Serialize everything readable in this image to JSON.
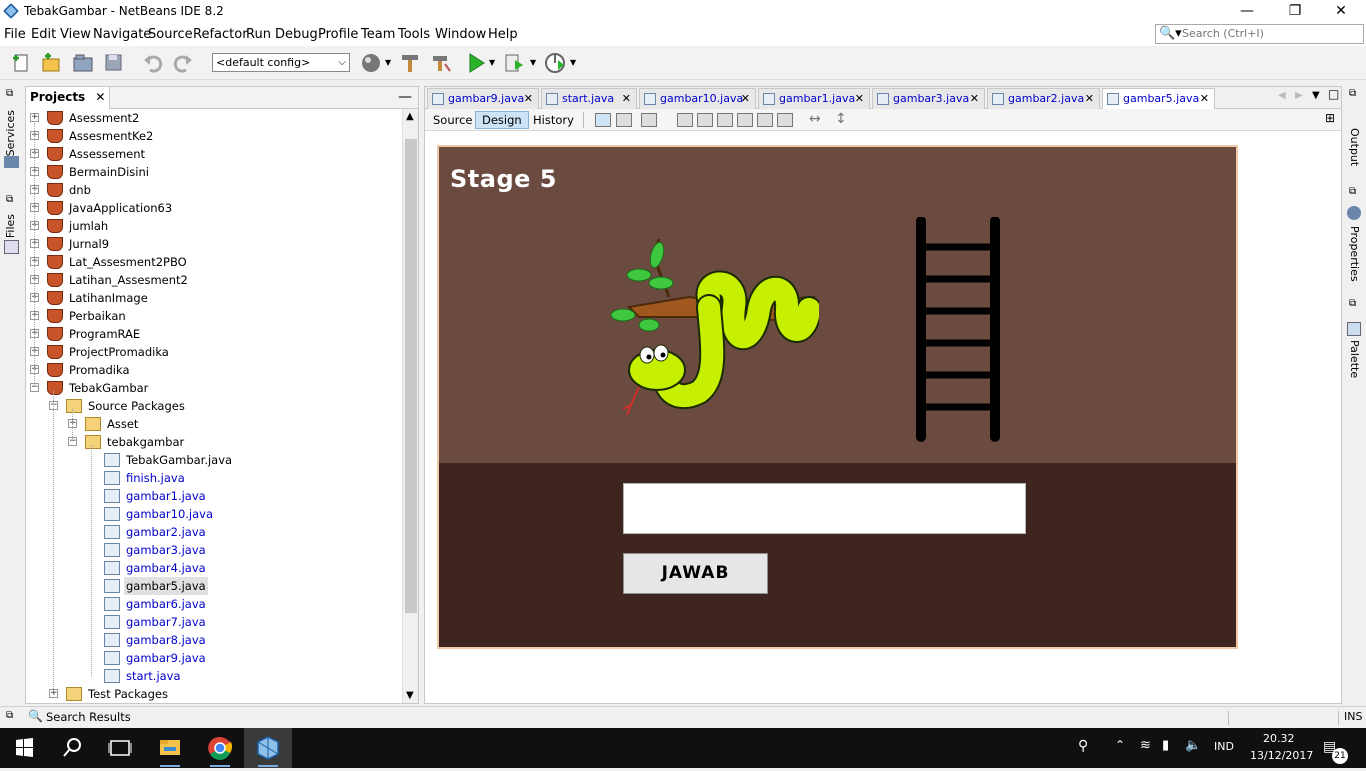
{
  "window": {
    "title": "TebakGambar - NetBeans IDE 8.2"
  },
  "menubar": [
    "File",
    "Edit",
    "View",
    "Navigate",
    "Source",
    "Refactor",
    "Run",
    "Debug",
    "Profile",
    "Team",
    "Tools",
    "Window",
    "Help"
  ],
  "search": {
    "placeholder": "Search (Ctrl+I)"
  },
  "toolbar": {
    "config_value": "<default config>"
  },
  "left_strip": {
    "services": "Services",
    "files": "Files"
  },
  "projects": {
    "title": "Projects",
    "items": [
      {
        "label": "Asessment2"
      },
      {
        "label": "AssesmentKe2"
      },
      {
        "label": "Assessement"
      },
      {
        "label": "BermainDisini"
      },
      {
        "label": "dnb"
      },
      {
        "label": "JavaApplication63"
      },
      {
        "label": "jumlah"
      },
      {
        "label": "Jurnal9"
      },
      {
        "label": "Lat_Assesment2PBO"
      },
      {
        "label": "Latihan_Assesment2"
      },
      {
        "label": "LatihanImage"
      },
      {
        "label": "Perbaikan"
      },
      {
        "label": "ProgramRAE"
      },
      {
        "label": "ProjectPromadika"
      },
      {
        "label": "Promadika"
      },
      {
        "label": "TebakGambar"
      },
      {
        "label": "Source Packages"
      },
      {
        "label": "Asset"
      },
      {
        "label": "tebakgambar"
      },
      {
        "label": "TebakGambar.java"
      },
      {
        "label": "finish.java"
      },
      {
        "label": "gambar1.java"
      },
      {
        "label": "gambar10.java"
      },
      {
        "label": "gambar2.java"
      },
      {
        "label": "gambar3.java"
      },
      {
        "label": "gambar4.java"
      },
      {
        "label": "gambar5.java"
      },
      {
        "label": "gambar6.java"
      },
      {
        "label": "gambar7.java"
      },
      {
        "label": "gambar8.java"
      },
      {
        "label": "gambar9.java"
      },
      {
        "label": "start.java"
      },
      {
        "label": "Test Packages"
      }
    ]
  },
  "editor": {
    "tabs": [
      "gambar9.java",
      "start.java",
      "gambar10.java",
      "gambar1.java",
      "gambar3.java",
      "gambar2.java",
      "gambar5.java"
    ],
    "active_tab": "gambar5.java",
    "views": {
      "source": "Source",
      "design": "Design",
      "history": "History"
    }
  },
  "form": {
    "stage_title": "Stage 5",
    "answer_value": "",
    "answer_button": "JAWAB"
  },
  "right_strip": {
    "output": "Output",
    "properties": "Properties",
    "palette": "Palette"
  },
  "status": {
    "search_results": "Search Results",
    "mode": "INS"
  },
  "taskbar": {
    "language": "IND",
    "time": "20.32",
    "date": "13/12/2017",
    "notifications": "21"
  },
  "colors": {
    "top_canvas": "#6b4a3f",
    "bottom_canvas": "#3e2520",
    "link_blue": "#0000cc"
  }
}
